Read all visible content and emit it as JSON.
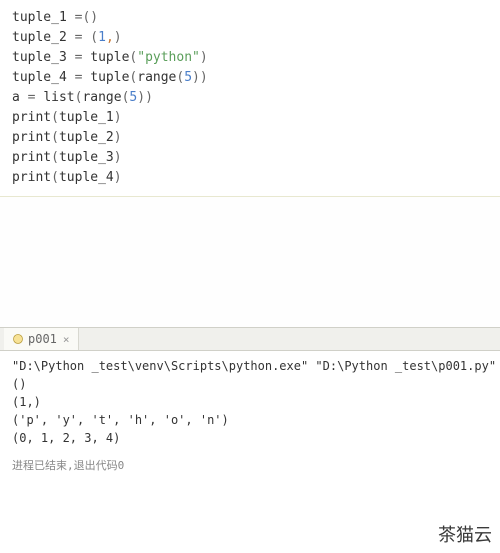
{
  "code": {
    "lines": [
      {
        "tokens": [
          {
            "t": "tuple_1 ",
            "c": "plain"
          },
          {
            "t": "=",
            "c": "op"
          },
          {
            "t": "()",
            "c": "paren"
          }
        ]
      },
      {
        "tokens": [
          {
            "t": "tuple_2 ",
            "c": "plain"
          },
          {
            "t": "= ",
            "c": "op"
          },
          {
            "t": "(",
            "c": "paren"
          },
          {
            "t": "1",
            "c": "num"
          },
          {
            "t": ",",
            "c": "comma"
          },
          {
            "t": ")",
            "c": "paren"
          }
        ]
      },
      {
        "tokens": [
          {
            "t": "tuple_3 ",
            "c": "plain"
          },
          {
            "t": "= ",
            "c": "op"
          },
          {
            "t": "tuple",
            "c": "plain"
          },
          {
            "t": "(",
            "c": "paren"
          },
          {
            "t": "\"python\"",
            "c": "str"
          },
          {
            "t": ")",
            "c": "paren"
          }
        ]
      },
      {
        "tokens": [
          {
            "t": "tuple_4 ",
            "c": "plain"
          },
          {
            "t": "= ",
            "c": "op"
          },
          {
            "t": "tuple",
            "c": "plain"
          },
          {
            "t": "(",
            "c": "paren"
          },
          {
            "t": "range",
            "c": "plain"
          },
          {
            "t": "(",
            "c": "paren"
          },
          {
            "t": "5",
            "c": "num"
          },
          {
            "t": "))",
            "c": "paren"
          }
        ]
      },
      {
        "tokens": [
          {
            "t": "a ",
            "c": "plain"
          },
          {
            "t": "= ",
            "c": "op"
          },
          {
            "t": "list",
            "c": "plain"
          },
          {
            "t": "(",
            "c": "paren"
          },
          {
            "t": "range",
            "c": "plain"
          },
          {
            "t": "(",
            "c": "paren"
          },
          {
            "t": "5",
            "c": "num"
          },
          {
            "t": "))",
            "c": "paren"
          }
        ]
      },
      {
        "tokens": [
          {
            "t": "print",
            "c": "plain"
          },
          {
            "t": "(",
            "c": "paren"
          },
          {
            "t": "tuple_1",
            "c": "plain"
          },
          {
            "t": ")",
            "c": "paren"
          }
        ]
      },
      {
        "tokens": [
          {
            "t": "print",
            "c": "plain"
          },
          {
            "t": "(",
            "c": "paren"
          },
          {
            "t": "tuple_2",
            "c": "plain"
          },
          {
            "t": ")",
            "c": "paren"
          }
        ]
      },
      {
        "tokens": [
          {
            "t": "print",
            "c": "plain"
          },
          {
            "t": "(",
            "c": "paren"
          },
          {
            "t": "tuple_3",
            "c": "plain"
          },
          {
            "t": ")",
            "c": "paren"
          }
        ]
      },
      {
        "tokens": [
          {
            "t": "print",
            "c": "plain"
          },
          {
            "t": "(",
            "c": "paren"
          },
          {
            "t": "tuple_4",
            "c": "plain"
          },
          {
            "t": ")",
            "c": "paren"
          }
        ]
      }
    ]
  },
  "tab": {
    "name": "p001",
    "close": "×"
  },
  "console": {
    "lines": [
      "\"D:\\Python _test\\venv\\Scripts\\python.exe\" \"D:\\Python _test\\p001.py\"",
      "()",
      "(1,)",
      "('p', 'y', 't', 'h', 'o', 'n')",
      "(0, 1, 2, 3, 4)"
    ]
  },
  "status": "进程已结束,退出代码0",
  "watermark": "茶猫云"
}
